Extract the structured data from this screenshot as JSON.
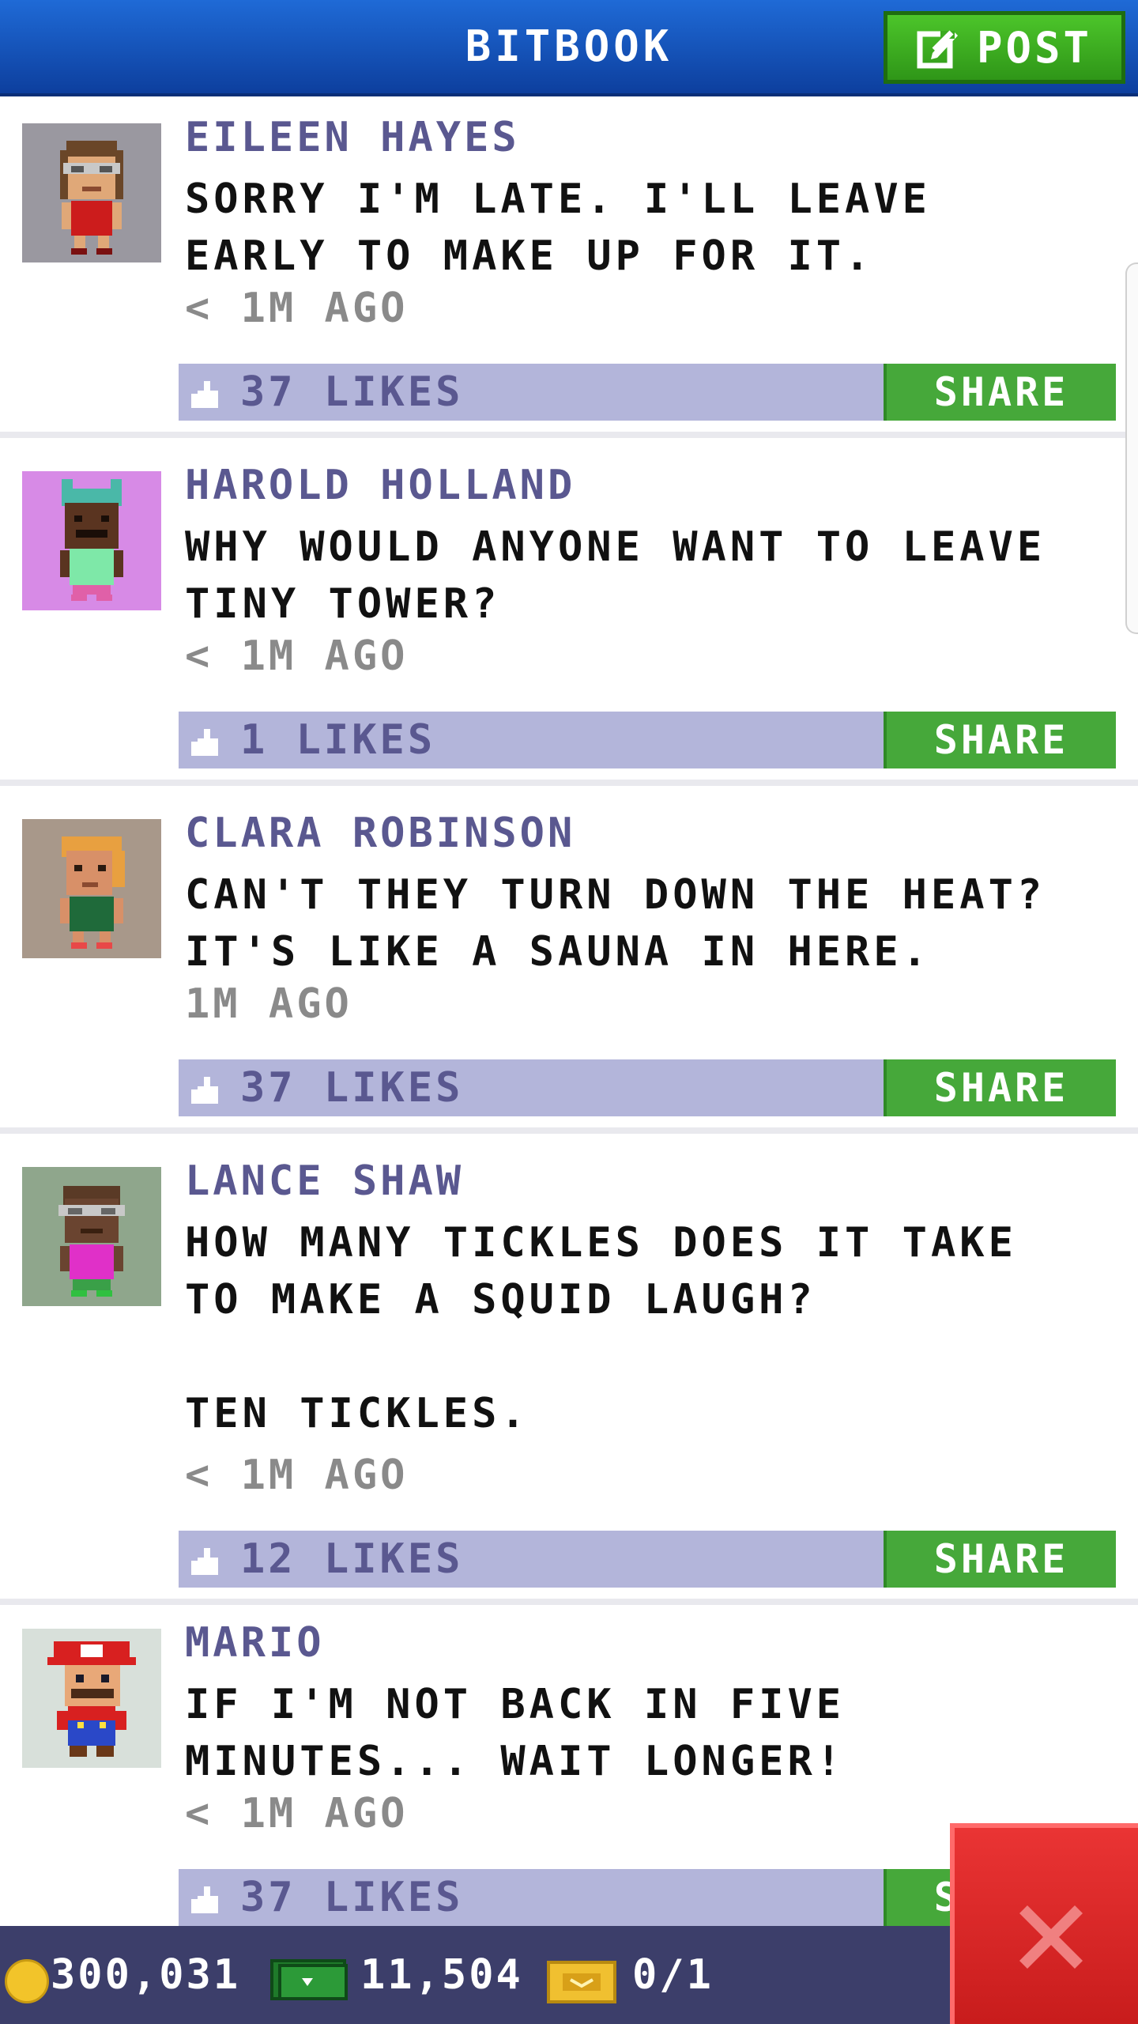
{
  "header": {
    "title": "BITBOOK",
    "post_label": "POST",
    "post_icon": "compose-icon"
  },
  "posts": [
    {
      "author": "EILEEN HAYES",
      "message": "SORRY I'M LATE. I'LL LEAVE EARLY TO MAKE UP FOR IT.",
      "time": "< 1M AGO",
      "likes": "37 LIKES",
      "share": "SHARE",
      "avatar_bg": "#9a98a0"
    },
    {
      "author": "HAROLD HOLLAND",
      "message": "WHY WOULD ANYONE WANT TO LEAVE TINY TOWER?",
      "time": "< 1M AGO",
      "likes": "1 LIKES",
      "share": "SHARE",
      "avatar_bg": "#d78ae6"
    },
    {
      "author": "CLARA ROBINSON",
      "message": "CAN'T THEY TURN DOWN THE HEAT? IT'S LIKE A SAUNA IN HERE.",
      "time": "1M AGO",
      "likes": "37 LIKES",
      "share": "SHARE",
      "avatar_bg": "#a8988a"
    },
    {
      "author": "LANCE SHAW",
      "message": "HOW MANY TICKLES DOES IT TAKE TO MAKE A SQUID LAUGH?\n\nTEN TICKLES.",
      "time": "< 1M AGO",
      "likes": "12 LIKES",
      "share": "SHARE",
      "avatar_bg": "#8fa68c"
    },
    {
      "author": "MARIO",
      "message": "IF I'M NOT BACK IN FIVE MINUTES... WAIT LONGER!",
      "time": "< 1M AGO",
      "likes": "37 LIKES",
      "share": "SHARE",
      "avatar_bg": "#d8e0da"
    }
  ],
  "footer": {
    "coins": "300,031",
    "bux": "11,504",
    "tickets": "0/1"
  },
  "colors": {
    "header": "#1b5ac4",
    "post_button": "#3bab20",
    "like_bar": "#b3b5da",
    "share_button": "#46a83a",
    "author_text": "#5a5890",
    "footer": "#3c3e6a",
    "close_button": "#d92424"
  }
}
